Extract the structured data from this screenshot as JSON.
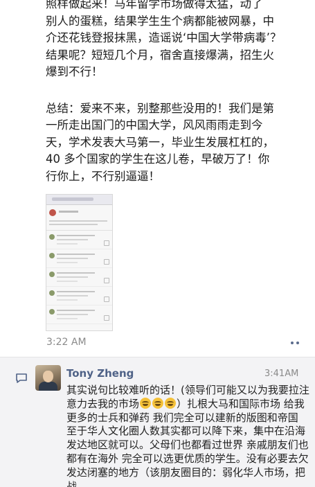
{
  "post": {
    "paragraphs": [
      {
        "lines": [
          "照样做起来！马年留学市场做得太猛，动了",
          "别人的蛋糕，结果学生生个病都能被网暴，中",
          "介还花钱登报抹黑，造谣说‘中国大学带病毒’？",
          "结果呢？短短几个月，宿舍直接爆满，招生火",
          "爆到不行！"
        ]
      },
      {
        "lines": [
          "总结：爱来不来，别整那些没用的！我们是第",
          "一所走出国门的中国大学，风风雨雨走到今",
          "天，学术发表大马第一，毕业生发展杠杠的，",
          "40 多个国家的学生在这儿卷，早破万了！你",
          "行你上，不行别逼逼！"
        ]
      }
    ],
    "time": "3:22 AM"
  },
  "comment": {
    "name": "Tony Zheng",
    "time": "3:41AM",
    "text_before_emoji": "其实说句比较难听的话！(领导们可能又以为我要拉注意力去我的市场",
    "emoji_count": 3,
    "emoji_icon": "laughing-emoji-icon",
    "text_after_emoji": "）扎根大马和国际市场 给我更多的士兵和弹药 我们完全可以建新的版图和帝国 至于华人文化圈人数其实都可以降下来，集中在沿海发达地区就可以。父母们也都看过世界 亲戚朋友们也都有在海外 完全可以选更优质的学生。没有必要去欠发达闭塞的地方（该朋友圈目的：弱化华人市场，把战"
  },
  "colors": {
    "name": "#4f6287",
    "meta": "#8a8a8a",
    "comment_bg": "#f3f3f5"
  }
}
